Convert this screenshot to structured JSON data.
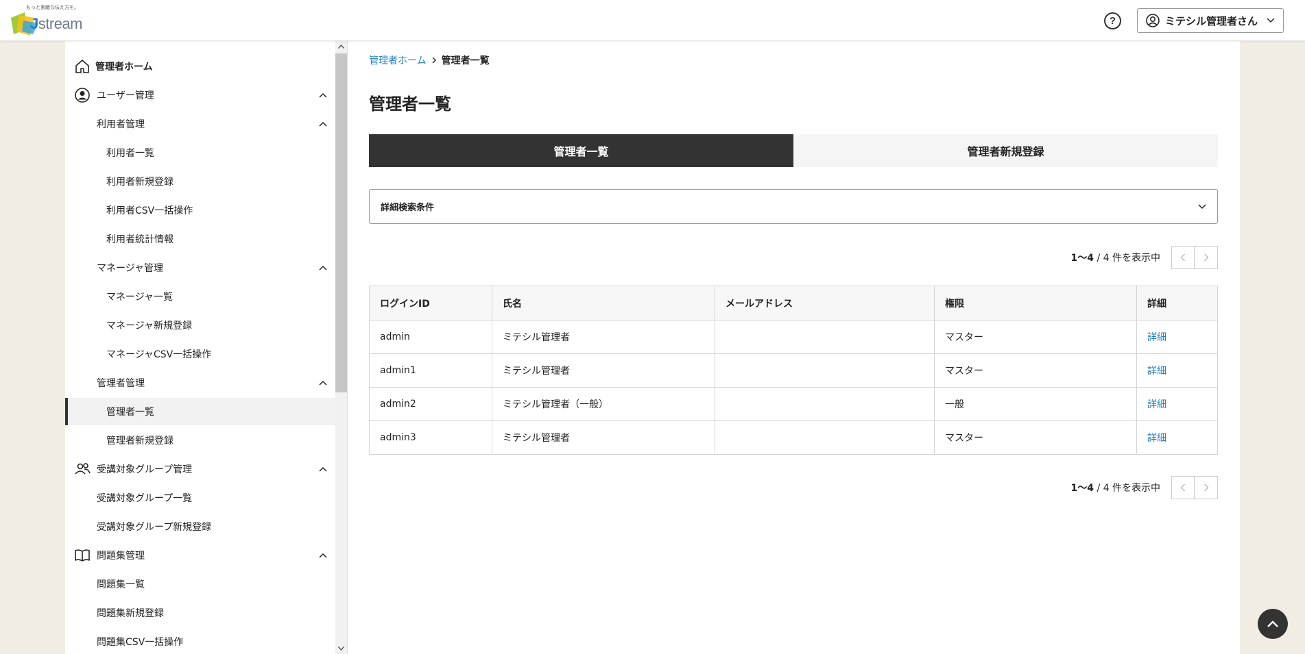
{
  "header": {
    "logo_tagline": "もっと素敵な伝え方を。",
    "logo_text_j": "J",
    "logo_text_rest": "stream",
    "help_icon": "question-circle-icon",
    "help_label": "?",
    "user_name": "ミテシル管理者さん"
  },
  "sidebar": {
    "items": [
      {
        "label": "管理者ホーム",
        "icon": "home-icon"
      },
      {
        "label": "ユーザー管理",
        "icon": "user-circle-icon"
      },
      {
        "label": "利用者管理"
      },
      {
        "label": "利用者一覧"
      },
      {
        "label": "利用者新規登録"
      },
      {
        "label": "利用者CSV一括操作"
      },
      {
        "label": "利用者統計情報"
      },
      {
        "label": "マネージャ管理"
      },
      {
        "label": "マネージャ一覧"
      },
      {
        "label": "マネージャ新規登録"
      },
      {
        "label": "マネージャCSV一括操作"
      },
      {
        "label": "管理者管理"
      },
      {
        "label": "管理者一覧"
      },
      {
        "label": "管理者新規登録"
      },
      {
        "label": "受講対象グループ管理",
        "icon": "users-icon"
      },
      {
        "label": "受講対象グループ一覧"
      },
      {
        "label": "受講対象グループ新規登録"
      },
      {
        "label": "問題集管理",
        "icon": "book-icon"
      },
      {
        "label": "問題集一覧"
      },
      {
        "label": "問題集新規登録"
      },
      {
        "label": "問題集CSV一括操作"
      }
    ]
  },
  "breadcrumb": {
    "home": "管理者ホーム",
    "current": "管理者一覧"
  },
  "page_title": "管理者一覧",
  "tabs": [
    {
      "label": "管理者一覧"
    },
    {
      "label": "管理者新規登録"
    }
  ],
  "search": {
    "label": "詳細検索条件"
  },
  "pager": {
    "range": "1〜4",
    "total_text": "/ 4 件を表示中"
  },
  "table": {
    "headers": [
      "ログインID",
      "氏名",
      "メールアドレス",
      "権限",
      "詳細"
    ],
    "rows": [
      {
        "login_id": "admin",
        "name": "ミテシル管理者",
        "email": "",
        "role": "マスター",
        "detail": "詳細"
      },
      {
        "login_id": "admin1",
        "name": "ミテシル管理者",
        "email": "",
        "role": "マスター",
        "detail": "詳細"
      },
      {
        "login_id": "admin2",
        "name": "ミテシル管理者（一般）",
        "email": "",
        "role": "一般",
        "detail": "詳細"
      },
      {
        "login_id": "admin3",
        "name": "ミテシル管理者",
        "email": "",
        "role": "マスター",
        "detail": "詳細"
      }
    ]
  },
  "colors": {
    "link": "#1f7fc0",
    "tab_active_bg": "#333333",
    "page_bg": "#f2ede4"
  }
}
